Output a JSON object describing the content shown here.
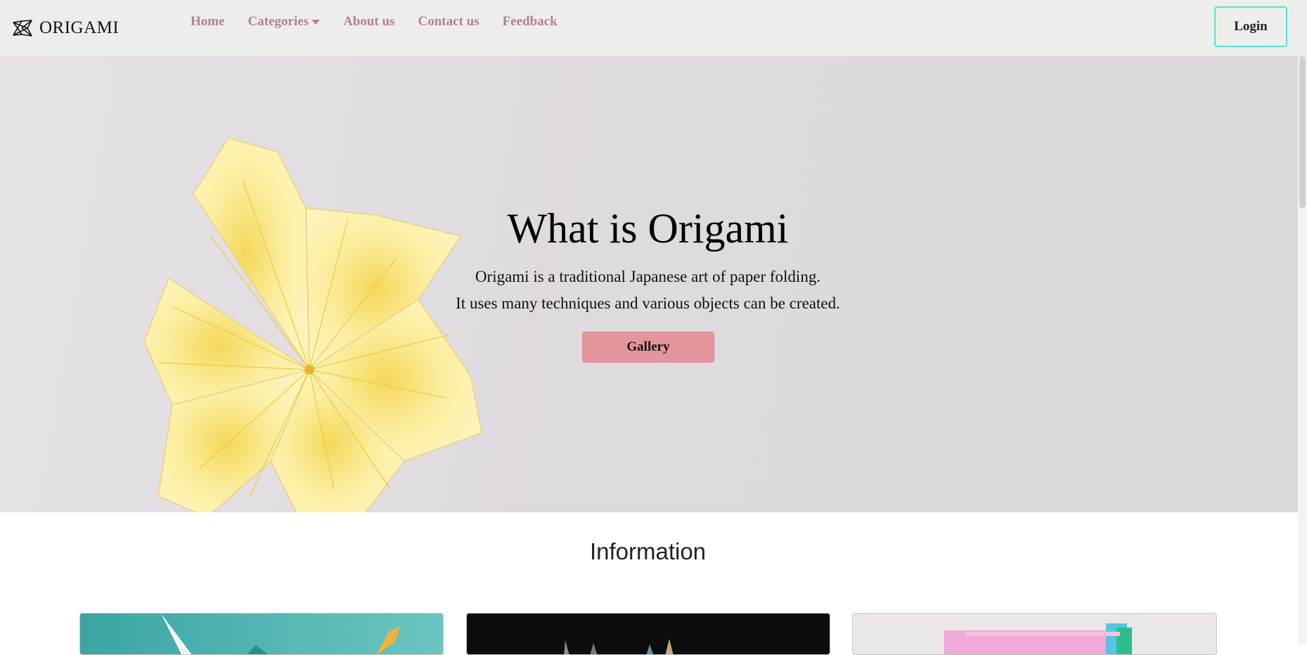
{
  "navbar": {
    "brand": "ORIGAMI",
    "links": [
      {
        "label": "Home"
      },
      {
        "label": "Categories",
        "has_dropdown": true
      },
      {
        "label": "About us"
      },
      {
        "label": "Contact us"
      },
      {
        "label": "Feedback"
      }
    ],
    "login_label": "Login"
  },
  "hero": {
    "title": "What is Origami",
    "line1": "Origami is a traditional Japanese art of paper folding.",
    "line2": "It uses many techniques and various objects can be created.",
    "gallery_label": "Gallery"
  },
  "info": {
    "title": "Information"
  },
  "colors": {
    "nav_link": "#b4808f",
    "login_border": "#55e0d9",
    "gallery_button": "#e4959c",
    "navbar_bg": "#edeeea"
  },
  "icons": {
    "brand": "origami-crane-icon",
    "dropdown": "caret-down-icon"
  }
}
